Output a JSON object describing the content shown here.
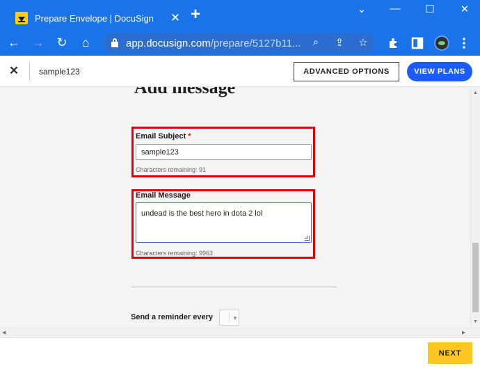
{
  "browser": {
    "tab_title": "Prepare Envelope | DocuSign",
    "tab_close": "✕",
    "new_tab": "+",
    "window_controls": {
      "minimize": "—",
      "maximize": "☐",
      "close": "✕",
      "chevron": "⌄"
    },
    "url_host": "app.docusign.com",
    "url_path": "/prepare/5127b11...",
    "nav": {
      "back": "←",
      "forward": "→",
      "reload": "↻",
      "home": "⌂"
    },
    "omnibox_icons": {
      "zoom": "⌕",
      "share": "⇪",
      "bookmark": "☆"
    }
  },
  "app": {
    "close_icon": "✕",
    "envelope_name": "sample123",
    "advanced_options_label": "ADVANCED OPTIONS",
    "view_plans_label": "VIEW PLANS"
  },
  "form": {
    "heading": "Add message",
    "email_subject": {
      "label": "Email Subject",
      "required_mark": "*",
      "value": "sample123",
      "hint": "Characters remaining: 91"
    },
    "email_message": {
      "label": "Email Message",
      "value": "undead is the best hero in dota 2 lol",
      "hint": "Characters remaining: 9963"
    },
    "reminder_label": "Send a reminder every"
  },
  "footer": {
    "next_label": "NEXT"
  },
  "colors": {
    "browser_blue": "#1a73e8",
    "highlight_red": "#e0000b",
    "view_plans_blue": "#1a5cff",
    "next_yellow": "#ffc820"
  }
}
